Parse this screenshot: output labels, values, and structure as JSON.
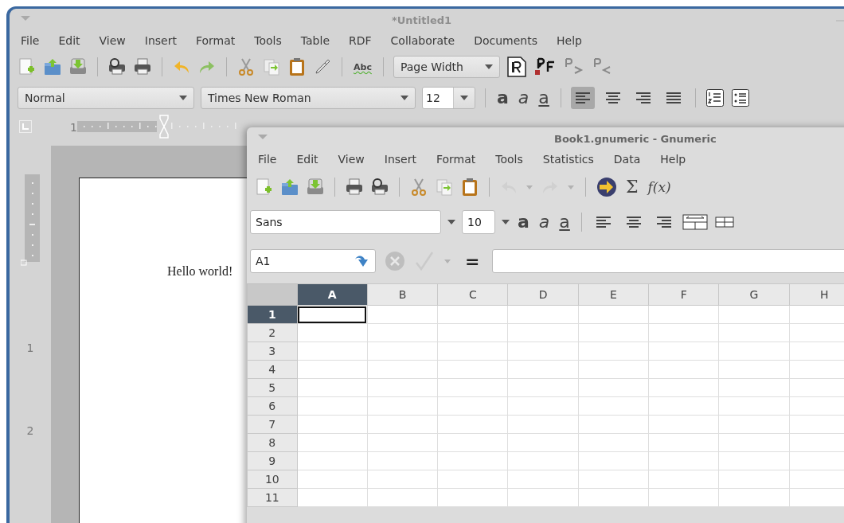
{
  "writer": {
    "title": "*Untitled1",
    "menu": [
      "File",
      "Edit",
      "View",
      "Insert",
      "Format",
      "Tools",
      "Table",
      "RDF",
      "Collaborate",
      "Documents",
      "Help"
    ],
    "toolbar": [
      {
        "kind": "new"
      },
      {
        "kind": "open"
      },
      {
        "kind": "save"
      },
      {
        "kind": "separator"
      },
      {
        "kind": "preview"
      },
      {
        "kind": "print"
      },
      {
        "kind": "separator"
      },
      {
        "kind": "undo",
        "disabled": false
      },
      {
        "kind": "redo",
        "disabled": false
      },
      {
        "kind": "separator"
      },
      {
        "kind": "cut"
      },
      {
        "kind": "copy"
      },
      {
        "kind": "paste"
      },
      {
        "kind": "clone"
      },
      {
        "kind": "separator"
      },
      {
        "kind": "spellcheck",
        "glyph": "Abc"
      },
      {
        "kind": "separator"
      },
      {
        "kind": "select",
        "value": "Page Width"
      },
      {
        "kind": "document"
      },
      {
        "kind": "marker"
      },
      {
        "kind": "chevron-right"
      },
      {
        "kind": "chevron-left"
      }
    ],
    "style": "Normal",
    "font": "Times New Roman",
    "size": "12",
    "format_buttons": [
      {
        "kind": "bold",
        "glyph": "a"
      },
      {
        "kind": "italic",
        "glyph": "a"
      },
      {
        "kind": "underline",
        "glyph": "a"
      }
    ],
    "align_buttons": [
      {
        "kind": "left",
        "selected": true
      },
      {
        "kind": "center",
        "selected": false
      },
      {
        "kind": "right",
        "selected": false
      },
      {
        "kind": "justify",
        "selected": false
      }
    ],
    "list_buttons": [
      {
        "kind": "numbered"
      },
      {
        "kind": "bullets"
      }
    ],
    "ruler": {
      "h_label": "1",
      "v_labels": [
        "1",
        "2"
      ]
    },
    "document_text": "Hello world!"
  },
  "gnumeric": {
    "title": "Book1.gnumeric - Gnumeric",
    "menu": [
      "File",
      "Edit",
      "View",
      "Insert",
      "Format",
      "Tools",
      "Statistics",
      "Data",
      "Help"
    ],
    "toolbar": [
      {
        "kind": "new"
      },
      {
        "kind": "open"
      },
      {
        "kind": "save"
      },
      {
        "kind": "separator"
      },
      {
        "kind": "print"
      },
      {
        "kind": "preview"
      },
      {
        "kind": "separator"
      },
      {
        "kind": "cut"
      },
      {
        "kind": "copy"
      },
      {
        "kind": "paste"
      },
      {
        "kind": "separator"
      },
      {
        "kind": "undo",
        "disabled": true
      },
      {
        "kind": "caret",
        "disabled": true
      },
      {
        "kind": "redo",
        "disabled": true
      },
      {
        "kind": "caret",
        "disabled": true
      },
      {
        "kind": "separator"
      },
      {
        "kind": "goto"
      },
      {
        "kind": "glyph",
        "glyph": "Σ"
      },
      {
        "kind": "function",
        "glyph": "f(x)"
      }
    ],
    "font": "Sans",
    "size": "10",
    "format_buttons": [
      {
        "kind": "bold",
        "glyph": "a"
      },
      {
        "kind": "italic",
        "glyph": "a"
      },
      {
        "kind": "underline",
        "glyph": "a"
      }
    ],
    "align_buttons": [
      {
        "kind": "left",
        "selected": false
      },
      {
        "kind": "center",
        "selected": false
      },
      {
        "kind": "right",
        "selected": false
      }
    ],
    "cell_tools": [
      {
        "kind": "merge"
      },
      {
        "kind": "borders"
      }
    ],
    "cell_ref": "A1",
    "equals": "=",
    "columns": [
      {
        "label": "A",
        "selected": true
      },
      {
        "label": "B",
        "selected": false
      },
      {
        "label": "C",
        "selected": false
      },
      {
        "label": "D",
        "selected": false
      },
      {
        "label": "E",
        "selected": false
      },
      {
        "label": "F",
        "selected": false
      },
      {
        "label": "G",
        "selected": false
      },
      {
        "label": "H",
        "selected": false
      }
    ],
    "rows": [
      {
        "label": "1",
        "selected": true
      },
      {
        "label": "2",
        "selected": false
      },
      {
        "label": "3",
        "selected": false
      },
      {
        "label": "4",
        "selected": false
      },
      {
        "label": "5",
        "selected": false
      },
      {
        "label": "6",
        "selected": false
      },
      {
        "label": "7",
        "selected": false
      },
      {
        "label": "8",
        "selected": false
      },
      {
        "label": "9",
        "selected": false
      },
      {
        "label": "10",
        "selected": false
      },
      {
        "label": "11",
        "selected": false
      }
    ]
  }
}
